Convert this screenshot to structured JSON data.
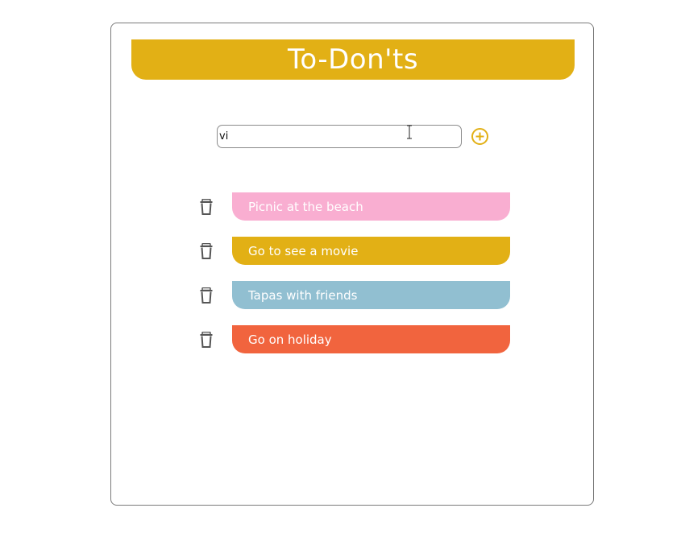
{
  "app": {
    "title": "To-Don'ts",
    "accent_color": "#e2b015"
  },
  "input": {
    "value": "vi",
    "placeholder": ""
  },
  "add_button": {
    "icon": "plus-circle-icon",
    "color": "#e2b015"
  },
  "items": [
    {
      "label": "Picnic at the beach",
      "color": "#f9aed1"
    },
    {
      "label": "Go to see a movie",
      "color": "#e2b015"
    },
    {
      "label": "Tapas with friends",
      "color": "#91bfd1"
    },
    {
      "label": "Go on holiday",
      "color": "#f1643e"
    }
  ],
  "item_icon": "trash-icon"
}
